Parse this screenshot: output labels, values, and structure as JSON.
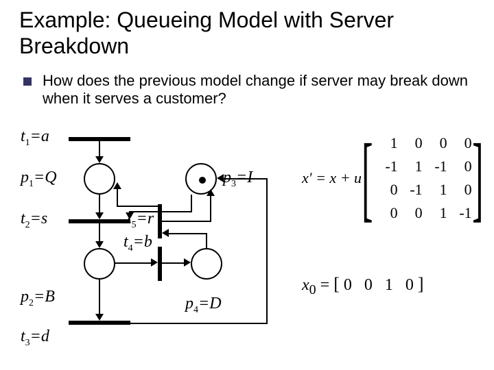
{
  "title_line1": "Example: Queueing Model with Server",
  "title_line2": "Breakdown",
  "bullet": "How does the previous model change if server may break down when it serves a customer?",
  "labels": {
    "t1": "t",
    "t1sub": "1",
    "t1eq": "=a",
    "p1": "p",
    "p1sub": "1",
    "p1eq": "=Q",
    "t2": "t",
    "t2sub": "2",
    "t2eq": "=s",
    "p2": "p",
    "p2sub": "2",
    "p2eq": "=B",
    "t3": "t",
    "t3sub": "3",
    "t3eq": "=d",
    "p3": "p",
    "p3sub": "3",
    "p3eq": "=I",
    "t4": "t",
    "t4sub": "4",
    "t4eq": "=b",
    "t5": "t",
    "t5sub": "5",
    "t5eq": "=r",
    "p4": "p",
    "p4sub": "4",
    "p4eq": "=D"
  },
  "matrix_lhs": "x′ = x + u",
  "matrix": [
    [
      "1",
      "0",
      "0",
      "0"
    ],
    [
      "-1",
      "1",
      "-1",
      "0"
    ],
    [
      "0",
      "-1",
      "1",
      "0"
    ],
    [
      "0",
      "0",
      "1",
      "-1"
    ]
  ],
  "x0_lhs": "x",
  "x0_sub": "0",
  "x0_eq": " = ",
  "x0_vec": [
    "0",
    "0",
    "1",
    "0"
  ]
}
